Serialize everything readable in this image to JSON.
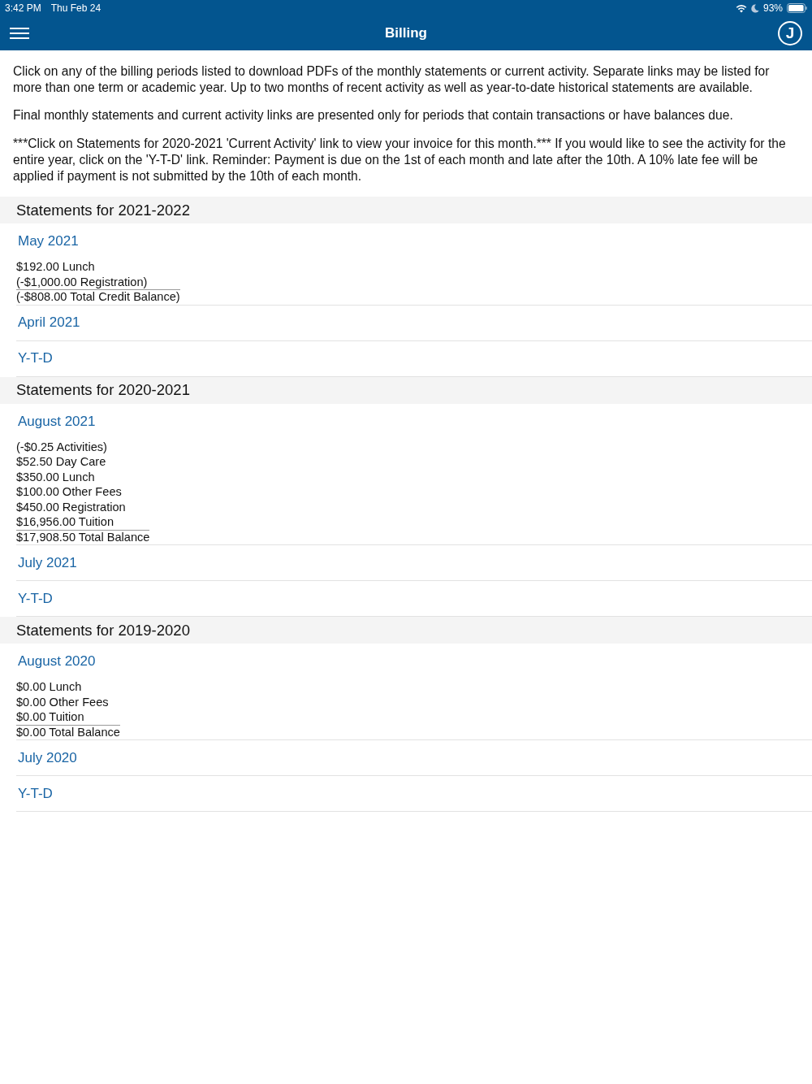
{
  "status_bar": {
    "time": "3:42 PM",
    "date": "Thu Feb 24",
    "battery": "93%"
  },
  "nav_bar": {
    "title": "Billing",
    "avatar": "J"
  },
  "intro": [
    "Click on any of the billing periods listed to download PDFs of the monthly statements or current activity. Separate links may be listed for more than one term or academic year. Up to two months of recent activity as well as year-to-date historical statements are available.",
    "Final monthly statements and current activity links are presented only for periods that contain transactions or have balances due.",
    "***Click on Statements for 2020-2021 'Current Activity' link to view your invoice for this month.*** If you would like to see the activity for the entire year, click on the 'Y-T-D' link. Reminder: Payment is due on the 1st of each month and late after the 10th. A 10% late fee will be applied if payment is not submitted by the 10th of each month."
  ],
  "sections": [
    {
      "title": "Statements for 2021-2022",
      "periods": [
        {
          "label": "May 2021",
          "lines": [
            "$192.00 Lunch",
            "(-$1,000.00 Registration)"
          ],
          "total": "(-$808.00 Total Credit Balance)"
        },
        {
          "label": "April 2021"
        },
        {
          "label": "Y-T-D"
        }
      ]
    },
    {
      "title": "Statements for 2020-2021",
      "periods": [
        {
          "label": "August 2021",
          "lines": [
            "(-$0.25 Activities)",
            "$52.50 Day Care",
            "$350.00 Lunch",
            "$100.00 Other Fees",
            "$450.00 Registration",
            "$16,956.00 Tuition"
          ],
          "total": "$17,908.50 Total Balance"
        },
        {
          "label": "July 2021"
        },
        {
          "label": "Y-T-D"
        }
      ]
    },
    {
      "title": "Statements for 2019-2020",
      "periods": [
        {
          "label": "August 2020",
          "lines": [
            "$0.00 Lunch",
            "$0.00 Other Fees",
            "$0.00 Tuition"
          ],
          "total": "$0.00 Total Balance"
        },
        {
          "label": "July 2020"
        },
        {
          "label": "Y-T-D"
        }
      ]
    }
  ]
}
